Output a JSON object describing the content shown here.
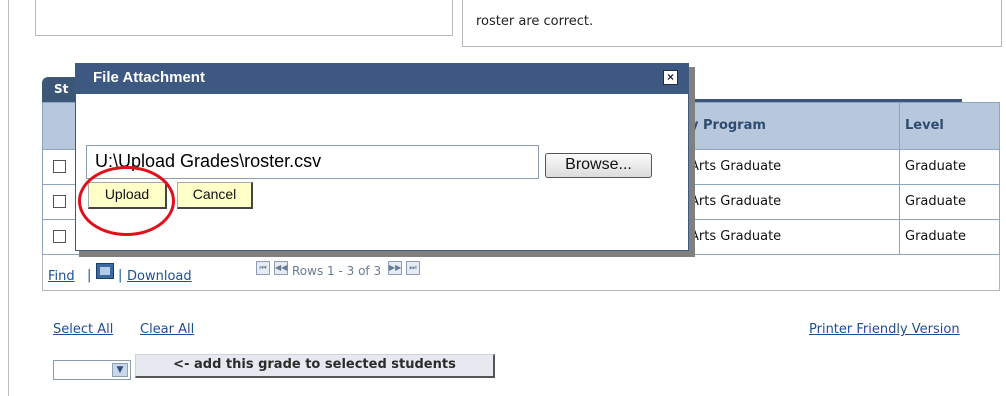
{
  "top_box": {
    "text": "roster are correct."
  },
  "tab": {
    "label": "St"
  },
  "grid": {
    "headers": {
      "program": "y Program",
      "level": "Level"
    },
    "rows": [
      {
        "program": "Arts Graduate",
        "level": "Graduate"
      },
      {
        "program": "Arts Graduate",
        "level": "Graduate"
      },
      {
        "program": "Arts Graduate",
        "level": "Graduate"
      }
    ],
    "footer": {
      "find": "Find",
      "pipe": "|",
      "download": "Download",
      "rows_text": "Rows 1 - 3 of 3"
    }
  },
  "actions": {
    "select_all": "Select All",
    "clear_all": "Clear All",
    "printer_friendly": "Printer Friendly Version",
    "add_grade_button": "<- add this grade to selected students"
  },
  "dialog": {
    "title": "File Attachment",
    "close_glyph": "×",
    "file_path": "U:\\Upload Grades\\roster.csv",
    "browse_label": "Browse...",
    "upload_label": "Upload",
    "cancel_label": "Cancel"
  },
  "icons": {
    "first": "⏮",
    "prev": "◀◀",
    "next": "▶▶",
    "last": "⏭",
    "dropdown": "▼"
  },
  "colors": {
    "dialog_title_bar": "#3d5881",
    "grid_header": "#b8c8dc",
    "button_bg": "#ffffc8",
    "highlight": "#e0101b",
    "link": "#1d4f91"
  }
}
